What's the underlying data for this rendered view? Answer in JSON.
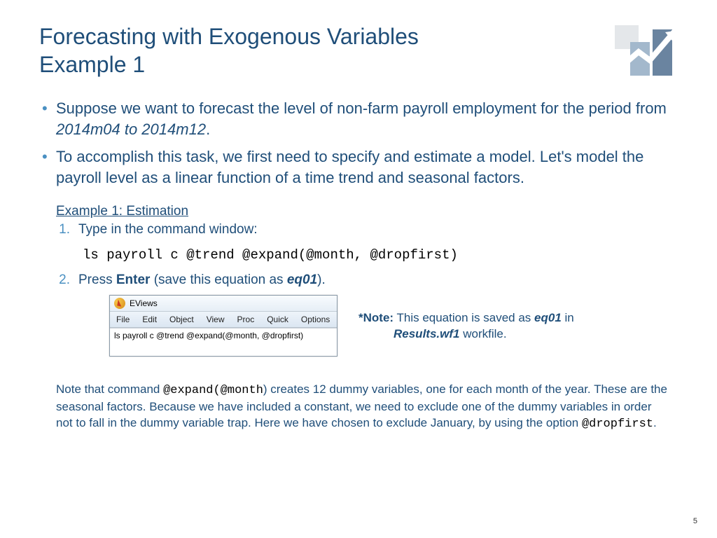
{
  "title_line1": "Forecasting with Exogenous Variables",
  "title_line2": "Example 1",
  "bullets": {
    "b1_pre": "Suppose we want to forecast the level of non-farm payroll employment for the period from ",
    "b1_italic": "2014m04 to 2014m12",
    "b1_post": ".",
    "b2": "To accomplish this task, we first need to specify and estimate a model. Let's model the payroll level as a linear function of a time trend and seasonal factors."
  },
  "example_heading": "Example 1: Estimation",
  "steps": {
    "n1": "1.",
    "s1": "Type in the command window:",
    "code": "ls payroll c @trend @expand(@month, @dropfirst)",
    "n2": "2.",
    "s2_pre": "Press ",
    "s2_enter": "Enter",
    "s2_mid": " (save this equation as ",
    "s2_eq": "eq01",
    "s2_post": ")."
  },
  "eviews": {
    "title": "EViews",
    "menu": [
      "File",
      "Edit",
      "Object",
      "View",
      "Proc",
      "Quick",
      "Options"
    ],
    "command": "ls payroll c @trend @expand(@month, @dropfirst)"
  },
  "note": {
    "star": "*Note:",
    "line1_pre": " This equation is saved as ",
    "eq": "eq01",
    "line1_post": " in",
    "line2_pre": "",
    "wf": "Results.wf1",
    "line2_post": " workfile."
  },
  "footnote": {
    "pre": "Note that command ",
    "code1": "@expand(@month",
    "mid": ") creates 12 dummy variables, one for each month of the year. These are the seasonal factors. Because we have included a constant, we need to exclude one of the dummy variables in order not to fall in the dummy variable trap. Here we have chosen to exclude January, by using the option ",
    "code2": "@dropfirst",
    "post": "."
  },
  "page_number": "5"
}
